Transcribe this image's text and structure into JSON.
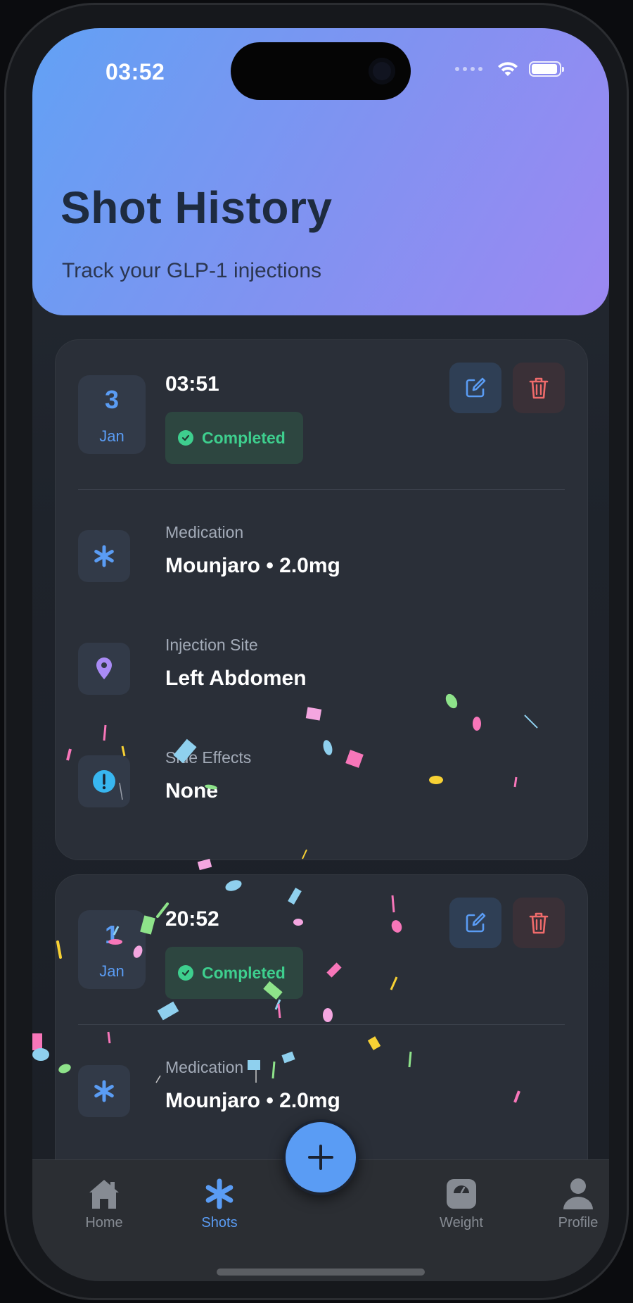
{
  "status_bar": {
    "time": "03:52"
  },
  "header": {
    "title": "Shot History",
    "subtitle": "Track your GLP-1 injections",
    "gradient": [
      "#62a1f4",
      "#9c88f2"
    ]
  },
  "shots": [
    {
      "day": "3",
      "month": "Jan",
      "time": "03:51",
      "status": "Completed",
      "details": [
        {
          "label": "Medication",
          "value": "Mounjaro • 2.0mg",
          "icon": "asterisk-icon"
        },
        {
          "label": "Injection Site",
          "value": "Left Abdomen",
          "icon": "location-pin-icon"
        },
        {
          "label": "Side Effects",
          "value": "None",
          "icon": "alert-circle-icon"
        }
      ]
    },
    {
      "day": "1",
      "month": "Jan",
      "time": "20:52",
      "status": "Completed",
      "details": [
        {
          "label": "Medication",
          "value": "Mounjaro • 2.0mg",
          "icon": "asterisk-icon"
        }
      ]
    }
  ],
  "tabbar": {
    "items": [
      {
        "label": "Home",
        "icon": "house-icon"
      },
      {
        "label": "Shots",
        "icon": "asterisk-icon",
        "active": true
      },
      {
        "label": "Weight",
        "icon": "scale-icon"
      },
      {
        "label": "Profile",
        "icon": "person-icon"
      }
    ],
    "add_icon": "plus-icon"
  },
  "colors": {
    "accent": "#5a9cf4",
    "success": "#3ecf8e",
    "danger": "#ef6b6b",
    "purple": "#a98bf5",
    "info": "#38b6f0"
  }
}
